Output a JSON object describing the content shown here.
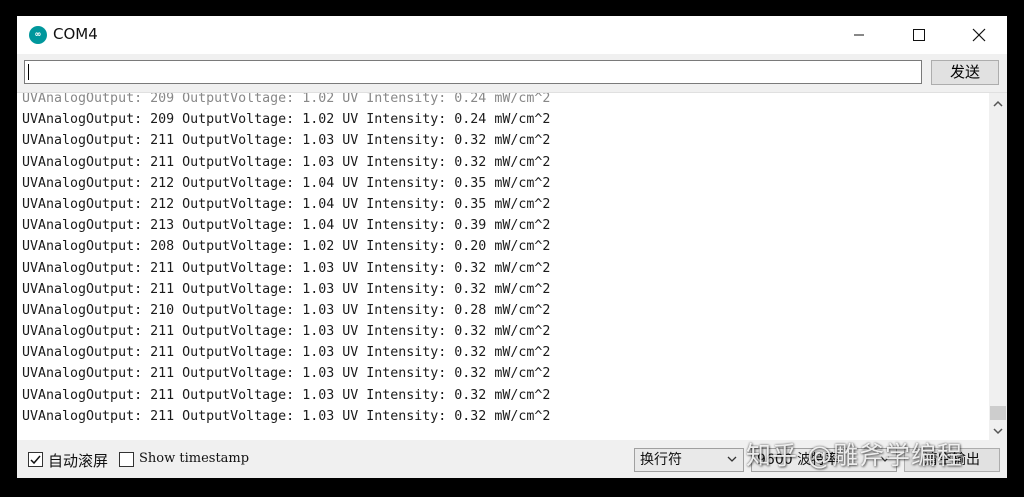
{
  "window": {
    "title": "COM4",
    "icon_text": "∞"
  },
  "send": {
    "input_value": "",
    "button_label": "发送"
  },
  "output": {
    "partial_top_line": "UVAnalogOutput: 209 OutputVoltage: 1.02 UV Intensity: 0.24 mW/cm^2",
    "lines": [
      "UVAnalogOutput: 209 OutputVoltage: 1.02 UV Intensity: 0.24 mW/cm^2",
      "UVAnalogOutput: 211 OutputVoltage: 1.03 UV Intensity: 0.32 mW/cm^2",
      "UVAnalogOutput: 211 OutputVoltage: 1.03 UV Intensity: 0.32 mW/cm^2",
      "UVAnalogOutput: 212 OutputVoltage: 1.04 UV Intensity: 0.35 mW/cm^2",
      "UVAnalogOutput: 212 OutputVoltage: 1.04 UV Intensity: 0.35 mW/cm^2",
      "UVAnalogOutput: 213 OutputVoltage: 1.04 UV Intensity: 0.39 mW/cm^2",
      "UVAnalogOutput: 208 OutputVoltage: 1.02 UV Intensity: 0.20 mW/cm^2",
      "UVAnalogOutput: 211 OutputVoltage: 1.03 UV Intensity: 0.32 mW/cm^2",
      "UVAnalogOutput: 211 OutputVoltage: 1.03 UV Intensity: 0.32 mW/cm^2",
      "UVAnalogOutput: 210 OutputVoltage: 1.03 UV Intensity: 0.28 mW/cm^2",
      "UVAnalogOutput: 211 OutputVoltage: 1.03 UV Intensity: 0.32 mW/cm^2",
      "UVAnalogOutput: 211 OutputVoltage: 1.03 UV Intensity: 0.32 mW/cm^2",
      "UVAnalogOutput: 211 OutputVoltage: 1.03 UV Intensity: 0.32 mW/cm^2",
      "UVAnalogOutput: 211 OutputVoltage: 1.03 UV Intensity: 0.32 mW/cm^2",
      "UVAnalogOutput: 211 OutputVoltage: 1.03 UV Intensity: 0.32 mW/cm^2"
    ]
  },
  "status": {
    "autoscroll_label": "自动滚屏",
    "autoscroll_checked": true,
    "timestamp_label": "Show timestamp",
    "timestamp_checked": false,
    "line_ending": "换行符",
    "baud": "9600 波特率",
    "clear_label": "清空输出"
  },
  "watermark": "知乎 @雕斧学编程",
  "colors": {
    "app_icon": "#00979c",
    "frame": "#000000",
    "toolbar": "#f0f0f0"
  }
}
